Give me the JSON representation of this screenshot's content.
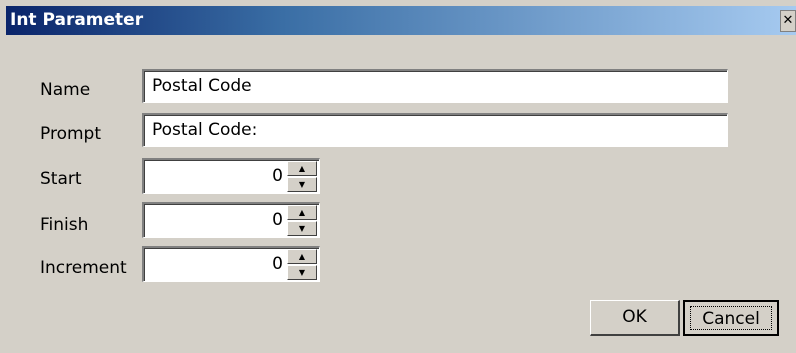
{
  "window": {
    "title": "Int Parameter",
    "close_glyph": "✕"
  },
  "fields": {
    "name": {
      "label": "Name",
      "value": "Postal Code"
    },
    "prompt": {
      "label": "Prompt",
      "value": "Postal Code:"
    },
    "start": {
      "label": "Start",
      "value": "0"
    },
    "finish": {
      "label": "Finish",
      "value": "0"
    },
    "increment": {
      "label": "Increment",
      "value": "0"
    }
  },
  "buttons": {
    "ok": "OK",
    "cancel": "Cancel"
  }
}
